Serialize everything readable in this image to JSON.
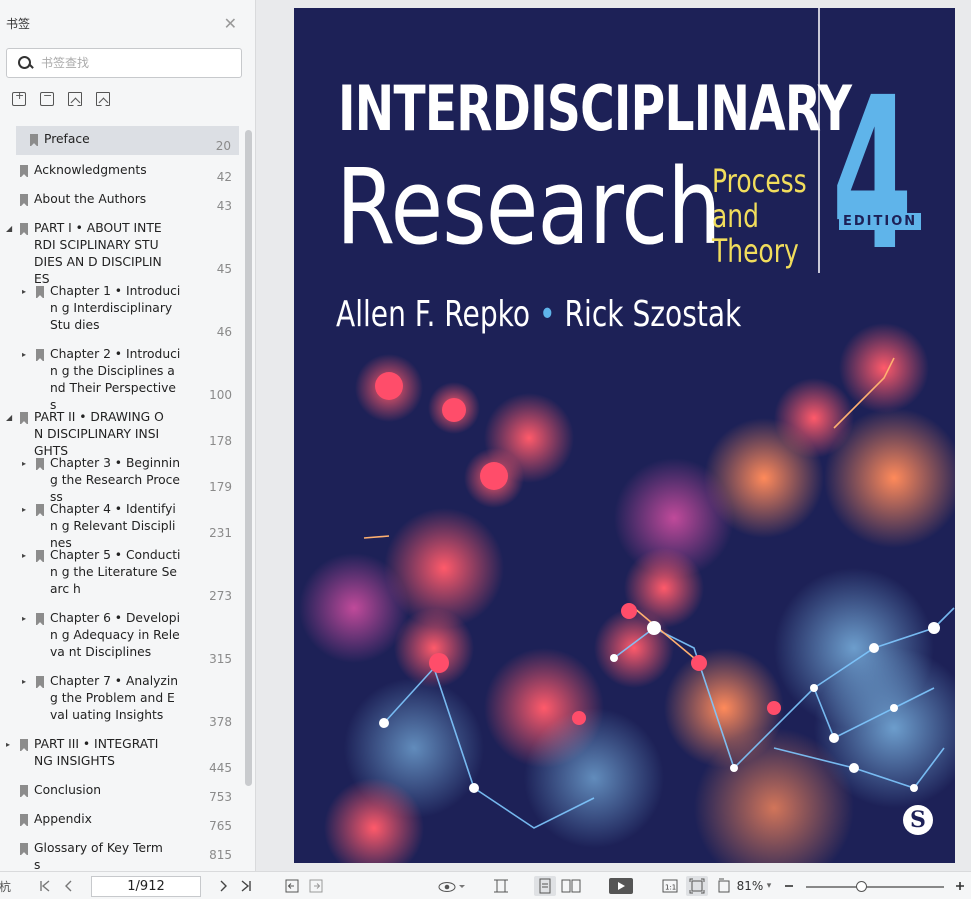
{
  "sidebar": {
    "title": "书签",
    "close_glyph": "✕",
    "search_placeholder": "书签查找",
    "tools": [
      "add-bookmark-icon",
      "remove-bookmark-icon",
      "bookmark-icon",
      "bookmark-outline-icon"
    ],
    "items": [
      {
        "label": "Preface",
        "page": "20",
        "arrow": "",
        "indent": 0,
        "selected": true
      },
      {
        "label": "Acknowledgments",
        "page": "42",
        "arrow": "",
        "indent": 0
      },
      {
        "label": "About the Authors",
        "page": "43",
        "arrow": "",
        "indent": 0
      },
      {
        "label": "PART I • ABOUT INTERDI SCIPLINARY STUDIES AN D DISCIPLINES",
        "page": "45",
        "arrow": "◢",
        "indent": 0
      },
      {
        "label": "Chapter 1 • Introducin g Interdisciplinary Stu dies",
        "page": "46",
        "arrow": "▸",
        "indent": 1
      },
      {
        "label": "Chapter 2 • Introducin g the Disciplines and Their Perspectives",
        "page": "100",
        "arrow": "▸",
        "indent": 1
      },
      {
        "label": "PART II • DRAWING ON DISCIPLINARY INSIGHTS",
        "page": "178",
        "arrow": "◢",
        "indent": 0
      },
      {
        "label": "Chapter 3 • Beginning the Research Process",
        "page": "179",
        "arrow": "▸",
        "indent": 1
      },
      {
        "label": "Chapter 4 • Identifyin g Relevant Disciplines",
        "page": "231",
        "arrow": "▸",
        "indent": 1
      },
      {
        "label": "Chapter 5 • Conductin g the Literature Searc h",
        "page": "273",
        "arrow": "▸",
        "indent": 1
      },
      {
        "label": "Chapter 6 • Developin g Adequacy in Releva nt Disciplines",
        "page": "315",
        "arrow": "▸",
        "indent": 1
      },
      {
        "label": "Chapter 7 • Analyzing the Problem and Eval uating Insights",
        "page": "378",
        "arrow": "▸",
        "indent": 1
      },
      {
        "label": "PART III • INTEGRATING INSIGHTS",
        "page": "445",
        "arrow": "▸",
        "indent": 0
      },
      {
        "label": "Conclusion",
        "page": "753",
        "arrow": "",
        "indent": 0
      },
      {
        "label": "Appendix",
        "page": "765",
        "arrow": "",
        "indent": 0
      },
      {
        "label": "Glossary of Key Terms",
        "page": "815",
        "arrow": "",
        "indent": 0
      }
    ]
  },
  "cover": {
    "title_line1": "INTERDISCIPLINARY",
    "title_line2": "Research",
    "subtitle_lines": [
      "Process",
      "and",
      "Theory"
    ],
    "edition_number": "4",
    "edition_label": "EDITION",
    "author1": "Allen F. Repko",
    "author_separator": "•",
    "author2": "Rick Szostak",
    "publisher_logo": "S",
    "colors": {
      "background": "#1d2157",
      "subtitle": "#f1dd5c",
      "accent": "#5fb4ea"
    }
  },
  "toolbar": {
    "left_fragment": "杭",
    "page_indicator": "1/912",
    "zoom": "81%",
    "zoom_dropdown": "▾",
    "zoom_level": 0.39
  }
}
